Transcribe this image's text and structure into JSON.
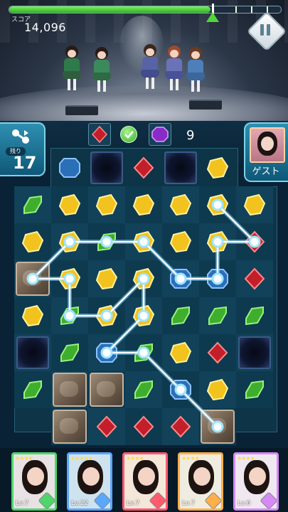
{
  "hud": {
    "score_label": "スコア",
    "score_value": "14,096",
    "progress_fraction": 0.74
  },
  "moves": {
    "label": "残り",
    "value": "17"
  },
  "goals": {
    "count": "9"
  },
  "guest": {
    "label": "ゲスト"
  },
  "colors": {
    "green_gem": "#3fae2f",
    "blue_gem": "#2a6fb8",
    "red_gem": "#c21f2a",
    "yellow_gem": "#f2c21e",
    "card_green": "#4ed66b",
    "card_blue": "#5aa7ff",
    "card_red": "#ff5a6e",
    "card_orange": "#ffb04a",
    "card_purple": "#d58af5"
  },
  "cards": [
    {
      "name": "member-1",
      "stars": "★★★★",
      "level": "Lv.7",
      "color": "#4ed66b",
      "bg": "#e9e2e4"
    },
    {
      "name": "member-2",
      "stars": "★★★★★",
      "level": "Lv.22",
      "color": "#5aa7ff",
      "bg": "#cfe3ee"
    },
    {
      "name": "member-3",
      "stars": "★★★★",
      "level": "Lv.7",
      "color": "#ff5a6e",
      "bg": "#f4e6d9"
    },
    {
      "name": "member-4",
      "stars": "★★★★",
      "level": "Lv.7",
      "color": "#ffb04a",
      "bg": "#f1ece0"
    },
    {
      "name": "member-5",
      "stars": "★★★★",
      "level": "Lv.6",
      "color": "#d58af5",
      "bg": "#f0e8f0"
    }
  ]
}
